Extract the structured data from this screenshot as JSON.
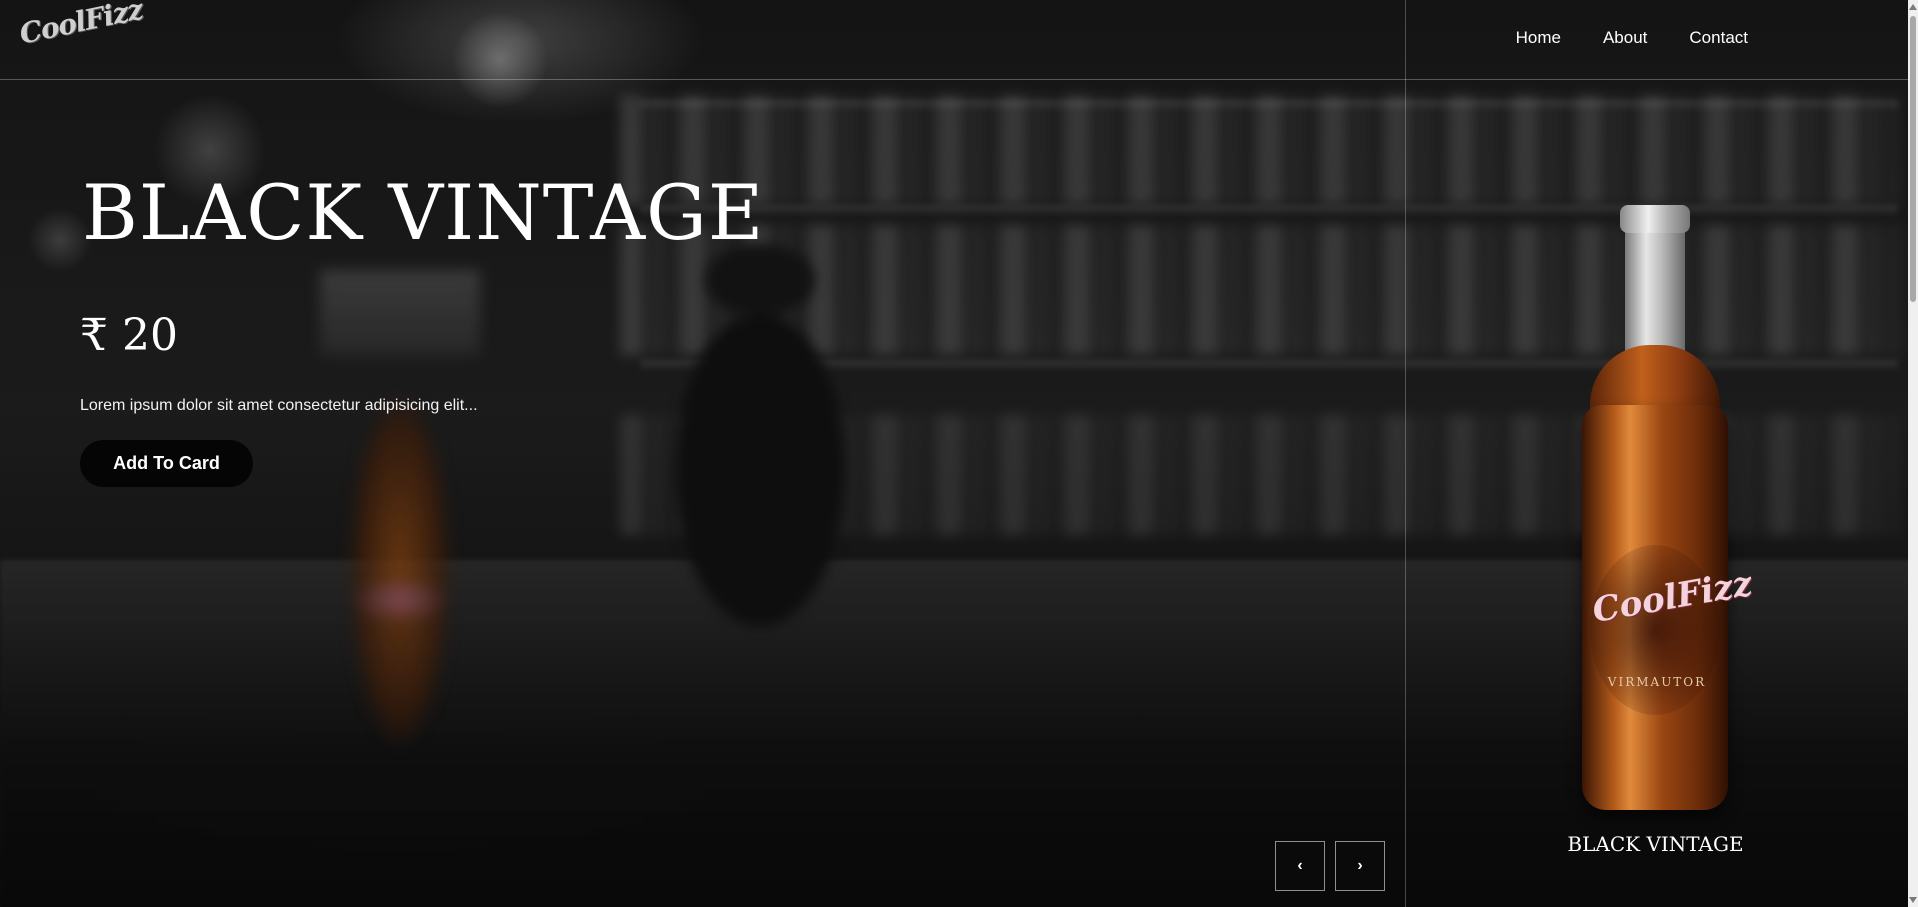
{
  "brand": {
    "logo_text": "CoolFizz"
  },
  "nav": {
    "items": [
      {
        "label": "Home"
      },
      {
        "label": "About"
      },
      {
        "label": "Contact"
      }
    ]
  },
  "hero": {
    "title": "BLACK VINTAGE",
    "price": "₹ 20",
    "description": "Lorem ipsum dolor sit amet consectetur adipisicing elit...",
    "cta_label": "Add To Card"
  },
  "carousel": {
    "prev_label": "‹",
    "next_label": "›"
  },
  "product": {
    "bottle_brand": "CoolFizz",
    "bottle_subtext": "VIRMAUTOR",
    "name": "BLACK VINTAGE"
  }
}
